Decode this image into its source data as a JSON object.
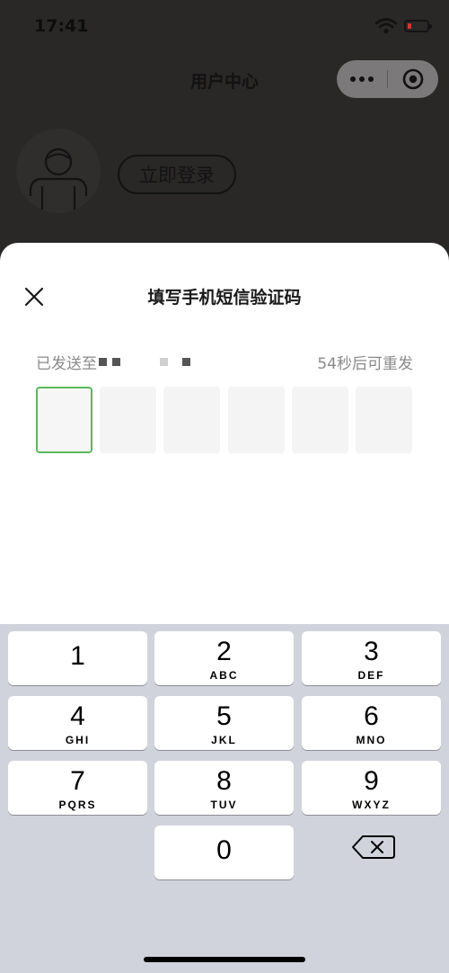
{
  "status_bar": {
    "time": "17:41"
  },
  "header": {
    "title": "用户中心"
  },
  "profile": {
    "login_label": "立即登录"
  },
  "sms_sheet": {
    "title": "填写手机短信验证码",
    "sent_prefix": "已发送至 ",
    "resend_countdown": "54秒后可重发",
    "code_length": 6,
    "code_value": ""
  },
  "keypad": {
    "keys": [
      {
        "digit": "1",
        "letters": ""
      },
      {
        "digit": "2",
        "letters": "ABC"
      },
      {
        "digit": "3",
        "letters": "DEF"
      },
      {
        "digit": "4",
        "letters": "GHI"
      },
      {
        "digit": "5",
        "letters": "JKL"
      },
      {
        "digit": "6",
        "letters": "MNO"
      },
      {
        "digit": "7",
        "letters": "PQRS"
      },
      {
        "digit": "8",
        "letters": "TUV"
      },
      {
        "digit": "9",
        "letters": "WXYZ"
      },
      {
        "digit": "0",
        "letters": ""
      }
    ],
    "delete_icon": "backspace-icon"
  },
  "colors": {
    "active_box_border": "#5cb85c",
    "keypad_bg": "#d1d3dc",
    "battery_low": "#d9332b"
  }
}
